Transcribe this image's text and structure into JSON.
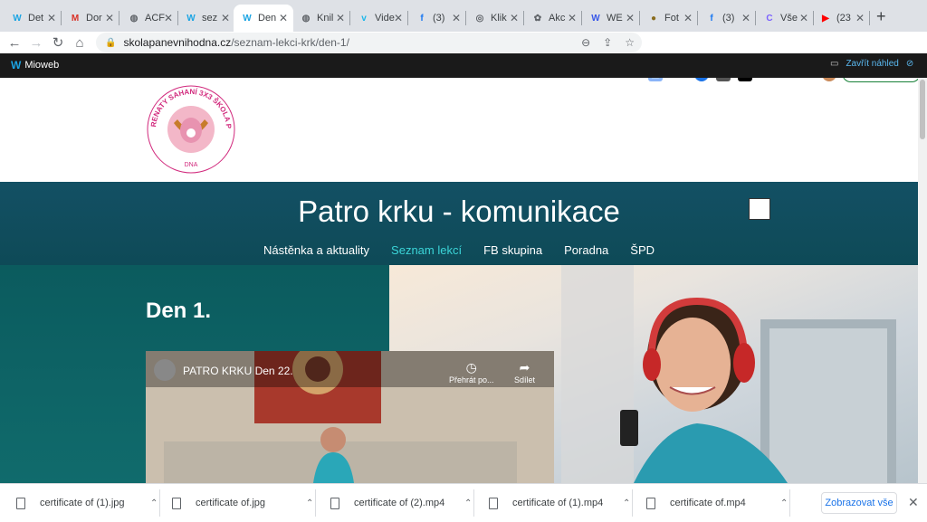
{
  "browser": {
    "tabs": [
      {
        "title": "Det",
        "icon": "mioweb-icon",
        "color": "#1ba4e3"
      },
      {
        "title": "Dor",
        "icon": "gmail-icon",
        "color": "#d93025"
      },
      {
        "title": "ACF",
        "icon": "globe-icon",
        "color": "#5f6368"
      },
      {
        "title": "sez",
        "icon": "mioweb-icon",
        "color": "#1ba4e3"
      },
      {
        "title": "Den",
        "icon": "mioweb-icon",
        "color": "#1ba4e3"
      },
      {
        "title": "Knil",
        "icon": "globe-icon",
        "color": "#5f6368"
      },
      {
        "title": "Vide",
        "icon": "vimeo-icon",
        "color": "#1ab7ea"
      },
      {
        "title": "(3)",
        "icon": "facebook-icon",
        "color": "#1877f2"
      },
      {
        "title": "Klik",
        "icon": "klik-icon",
        "color": "#5f6368"
      },
      {
        "title": "Akc",
        "icon": "akce-icon",
        "color": "#5f6368"
      },
      {
        "title": "WE",
        "icon": "wordpress-icon",
        "color": "#3858e9"
      },
      {
        "title": "Fot",
        "icon": "photo-icon",
        "color": "#8a6d1f"
      },
      {
        "title": "(3)",
        "icon": "facebook-icon",
        "color": "#1877f2"
      },
      {
        "title": "Vše",
        "icon": "c-icon",
        "color": "#7b61ff"
      },
      {
        "title": "(23",
        "icon": "youtube-icon",
        "color": "#ff0000"
      }
    ],
    "url_host": "skolapanevnihodna.cz",
    "url_path": "/seznam-lekci-krk/den-1/",
    "update_label": "Aktualizovat"
  },
  "mioweb": {
    "brand": "Mioweb",
    "close_preview": "Zavřít náhled"
  },
  "site": {
    "logo_text": "RENATY SAHANÍ 3X3 ŠKOLA PÁNEVNÍHO DNA",
    "title": "Patro krku - komunikace",
    "nav": [
      "Nástěnka a aktuality",
      "Seznam lekcí",
      "FB skupina",
      "Poradna",
      "ŠPD"
    ],
    "nav_active": 1,
    "heading": "Den 1.",
    "video_title": "PATRO KRKU Den 22.",
    "video_watch_later": "Přehrát po...",
    "video_share": "Sdílet"
  },
  "downloads": {
    "items": [
      "certificate of (1).jpg",
      "certificate of.jpg",
      "certificate of (2).mp4",
      "certificate of (1).mp4",
      "certificate of.mp4"
    ],
    "show_all": "Zobrazovat vše"
  }
}
